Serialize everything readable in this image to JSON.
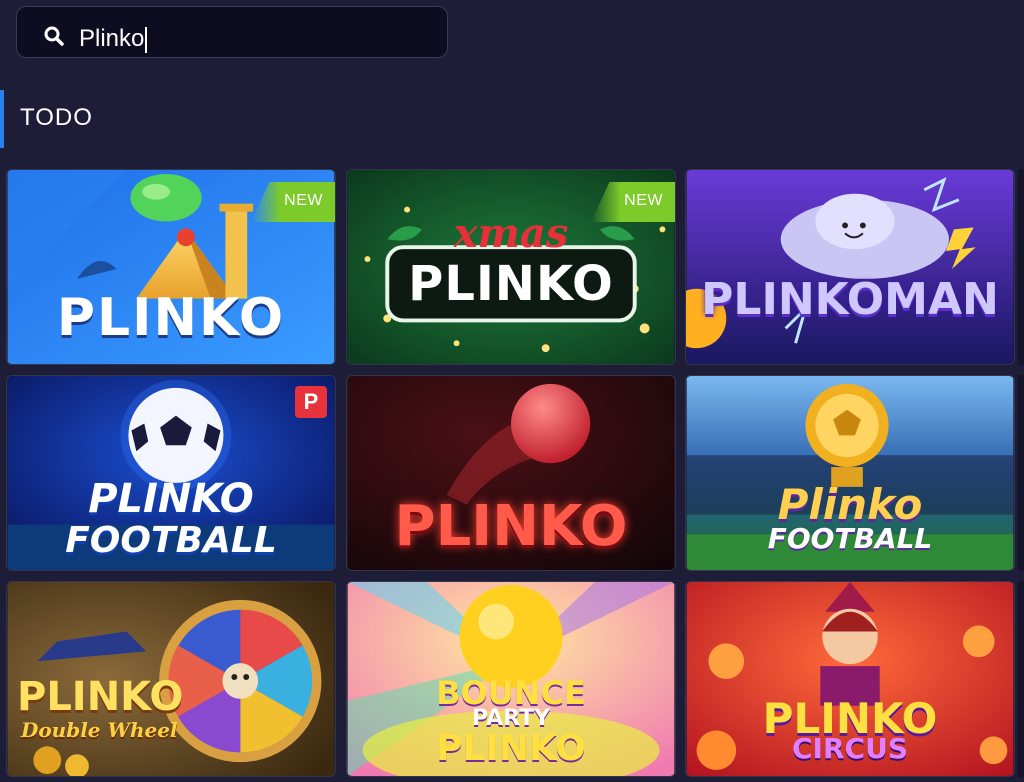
{
  "search": {
    "value": "Plinko"
  },
  "section": {
    "title": "TODO"
  },
  "badges": {
    "new": "NEW",
    "provider": "P"
  },
  "games": [
    {
      "title": "PLINKO",
      "badge": "NEW"
    },
    {
      "title_top": "xmas",
      "title": "PLINKO",
      "badge": "NEW"
    },
    {
      "title": "PLINKOMAN"
    },
    {
      "title": "PLINKO",
      "subtitle": "FOOTBALL",
      "badge": "P"
    },
    {
      "title": "PLINKO"
    },
    {
      "title": "Plinko",
      "subtitle": "FOOTBALL"
    },
    {
      "title": "PLINKO",
      "subtitle": "Double Wheel"
    },
    {
      "title_top": "BOUNCE",
      "title_mid": "PARTY",
      "title": "PLINKO"
    },
    {
      "title": "PLINKO",
      "subtitle": "CIRCUS"
    }
  ],
  "colors": {
    "background": "#1d1d37",
    "accent": "#2d7ff0",
    "new_badge": "#7ccb2a",
    "provider_badge": "#e8333c"
  }
}
